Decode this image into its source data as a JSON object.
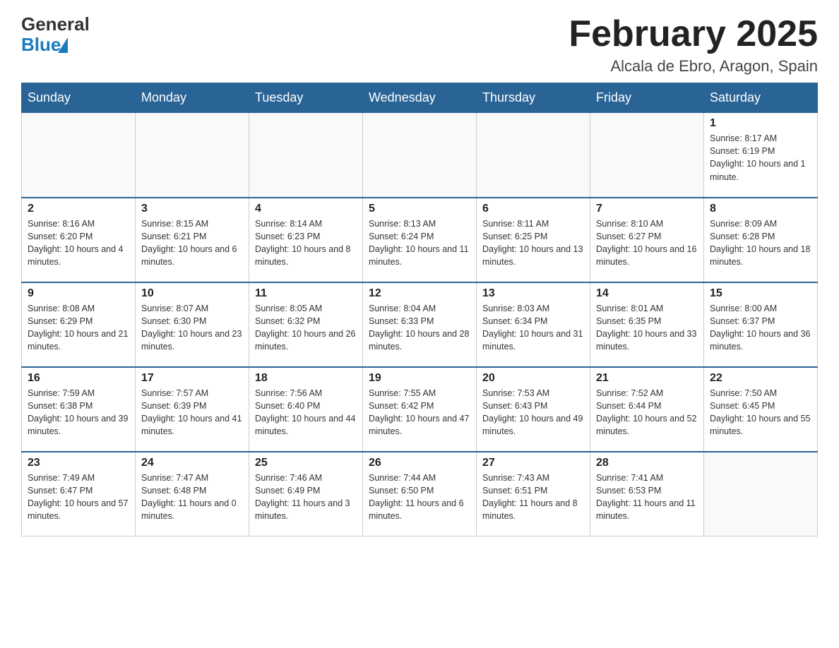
{
  "header": {
    "logo_general": "General",
    "logo_blue": "Blue",
    "month_title": "February 2025",
    "location": "Alcala de Ebro, Aragon, Spain"
  },
  "days_of_week": [
    "Sunday",
    "Monday",
    "Tuesday",
    "Wednesday",
    "Thursday",
    "Friday",
    "Saturday"
  ],
  "weeks": [
    [
      {
        "day": "",
        "info": ""
      },
      {
        "day": "",
        "info": ""
      },
      {
        "day": "",
        "info": ""
      },
      {
        "day": "",
        "info": ""
      },
      {
        "day": "",
        "info": ""
      },
      {
        "day": "",
        "info": ""
      },
      {
        "day": "1",
        "info": "Sunrise: 8:17 AM\nSunset: 6:19 PM\nDaylight: 10 hours and 1 minute."
      }
    ],
    [
      {
        "day": "2",
        "info": "Sunrise: 8:16 AM\nSunset: 6:20 PM\nDaylight: 10 hours and 4 minutes."
      },
      {
        "day": "3",
        "info": "Sunrise: 8:15 AM\nSunset: 6:21 PM\nDaylight: 10 hours and 6 minutes."
      },
      {
        "day": "4",
        "info": "Sunrise: 8:14 AM\nSunset: 6:23 PM\nDaylight: 10 hours and 8 minutes."
      },
      {
        "day": "5",
        "info": "Sunrise: 8:13 AM\nSunset: 6:24 PM\nDaylight: 10 hours and 11 minutes."
      },
      {
        "day": "6",
        "info": "Sunrise: 8:11 AM\nSunset: 6:25 PM\nDaylight: 10 hours and 13 minutes."
      },
      {
        "day": "7",
        "info": "Sunrise: 8:10 AM\nSunset: 6:27 PM\nDaylight: 10 hours and 16 minutes."
      },
      {
        "day": "8",
        "info": "Sunrise: 8:09 AM\nSunset: 6:28 PM\nDaylight: 10 hours and 18 minutes."
      }
    ],
    [
      {
        "day": "9",
        "info": "Sunrise: 8:08 AM\nSunset: 6:29 PM\nDaylight: 10 hours and 21 minutes."
      },
      {
        "day": "10",
        "info": "Sunrise: 8:07 AM\nSunset: 6:30 PM\nDaylight: 10 hours and 23 minutes."
      },
      {
        "day": "11",
        "info": "Sunrise: 8:05 AM\nSunset: 6:32 PM\nDaylight: 10 hours and 26 minutes."
      },
      {
        "day": "12",
        "info": "Sunrise: 8:04 AM\nSunset: 6:33 PM\nDaylight: 10 hours and 28 minutes."
      },
      {
        "day": "13",
        "info": "Sunrise: 8:03 AM\nSunset: 6:34 PM\nDaylight: 10 hours and 31 minutes."
      },
      {
        "day": "14",
        "info": "Sunrise: 8:01 AM\nSunset: 6:35 PM\nDaylight: 10 hours and 33 minutes."
      },
      {
        "day": "15",
        "info": "Sunrise: 8:00 AM\nSunset: 6:37 PM\nDaylight: 10 hours and 36 minutes."
      }
    ],
    [
      {
        "day": "16",
        "info": "Sunrise: 7:59 AM\nSunset: 6:38 PM\nDaylight: 10 hours and 39 minutes."
      },
      {
        "day": "17",
        "info": "Sunrise: 7:57 AM\nSunset: 6:39 PM\nDaylight: 10 hours and 41 minutes."
      },
      {
        "day": "18",
        "info": "Sunrise: 7:56 AM\nSunset: 6:40 PM\nDaylight: 10 hours and 44 minutes."
      },
      {
        "day": "19",
        "info": "Sunrise: 7:55 AM\nSunset: 6:42 PM\nDaylight: 10 hours and 47 minutes."
      },
      {
        "day": "20",
        "info": "Sunrise: 7:53 AM\nSunset: 6:43 PM\nDaylight: 10 hours and 49 minutes."
      },
      {
        "day": "21",
        "info": "Sunrise: 7:52 AM\nSunset: 6:44 PM\nDaylight: 10 hours and 52 minutes."
      },
      {
        "day": "22",
        "info": "Sunrise: 7:50 AM\nSunset: 6:45 PM\nDaylight: 10 hours and 55 minutes."
      }
    ],
    [
      {
        "day": "23",
        "info": "Sunrise: 7:49 AM\nSunset: 6:47 PM\nDaylight: 10 hours and 57 minutes."
      },
      {
        "day": "24",
        "info": "Sunrise: 7:47 AM\nSunset: 6:48 PM\nDaylight: 11 hours and 0 minutes."
      },
      {
        "day": "25",
        "info": "Sunrise: 7:46 AM\nSunset: 6:49 PM\nDaylight: 11 hours and 3 minutes."
      },
      {
        "day": "26",
        "info": "Sunrise: 7:44 AM\nSunset: 6:50 PM\nDaylight: 11 hours and 6 minutes."
      },
      {
        "day": "27",
        "info": "Sunrise: 7:43 AM\nSunset: 6:51 PM\nDaylight: 11 hours and 8 minutes."
      },
      {
        "day": "28",
        "info": "Sunrise: 7:41 AM\nSunset: 6:53 PM\nDaylight: 11 hours and 11 minutes."
      },
      {
        "day": "",
        "info": ""
      }
    ]
  ]
}
